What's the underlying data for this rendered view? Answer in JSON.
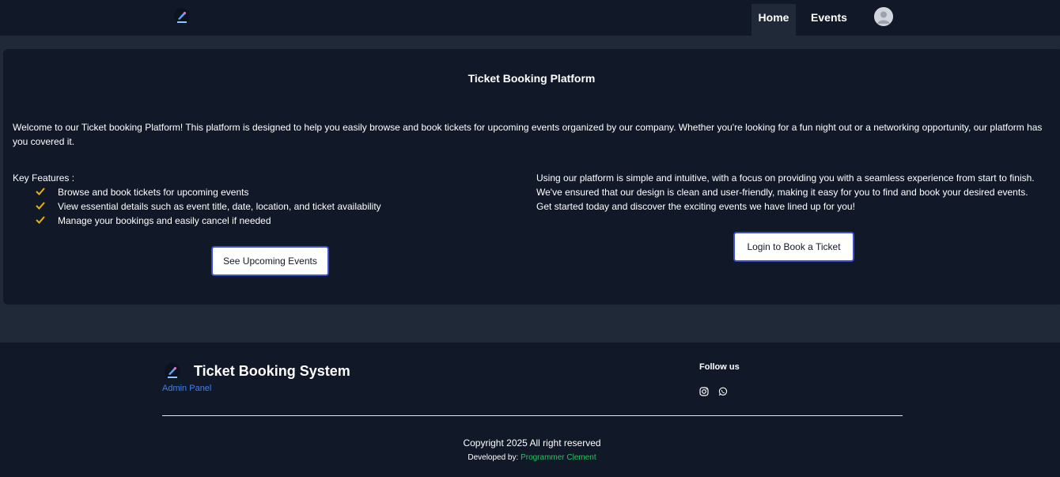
{
  "navbar": {
    "logo_icon": "rocket-logo-icon",
    "items": [
      {
        "label": "Home",
        "active": true
      },
      {
        "label": "Events",
        "active": false
      }
    ],
    "avatar_icon": "user-avatar-icon"
  },
  "hero": {
    "title": "Ticket Booking Platform",
    "intro": "Welcome to our Ticket booking Platform! This platform is designed to help you easily browse and book tickets for upcoming events organized by our company. Whether you're looking for a fun night out or a networking opportunity, our platform has you covered it.",
    "features_label": "Key Features :",
    "features": [
      "Browse and book tickets for upcoming events",
      "View essential details such as event title, date, location, and ticket availability",
      "Manage your bookings and easily cancel if needed"
    ],
    "right_lines": [
      "Using our platform is simple and intuitive, with a focus on providing you with a seamless experience from start to finish.",
      "We've ensured that our design is clean and user-friendly, making it easy for you to find and book your desired events.",
      "Get started today and discover the exciting events we have lined up for you!"
    ],
    "events_button": "See Upcoming Events",
    "login_button": "Login to Book a Ticket",
    "check_color": "#eab308"
  },
  "footer": {
    "brand": "Ticket Booking System",
    "admin_link": "Admin Panel",
    "follow_label": "Follow us",
    "social_icons": [
      "instagram-icon",
      "whatsapp-icon"
    ],
    "copyright": "Copyright 2025 All right reserved",
    "developed_by_label": "Developed by:",
    "developer_name": "Programmer Clement"
  },
  "colors": {
    "background": "#1f2937",
    "surface": "#111827",
    "link_blue": "#3b82f6",
    "link_green": "#22c55e",
    "button_border": "#3b4fc8"
  }
}
